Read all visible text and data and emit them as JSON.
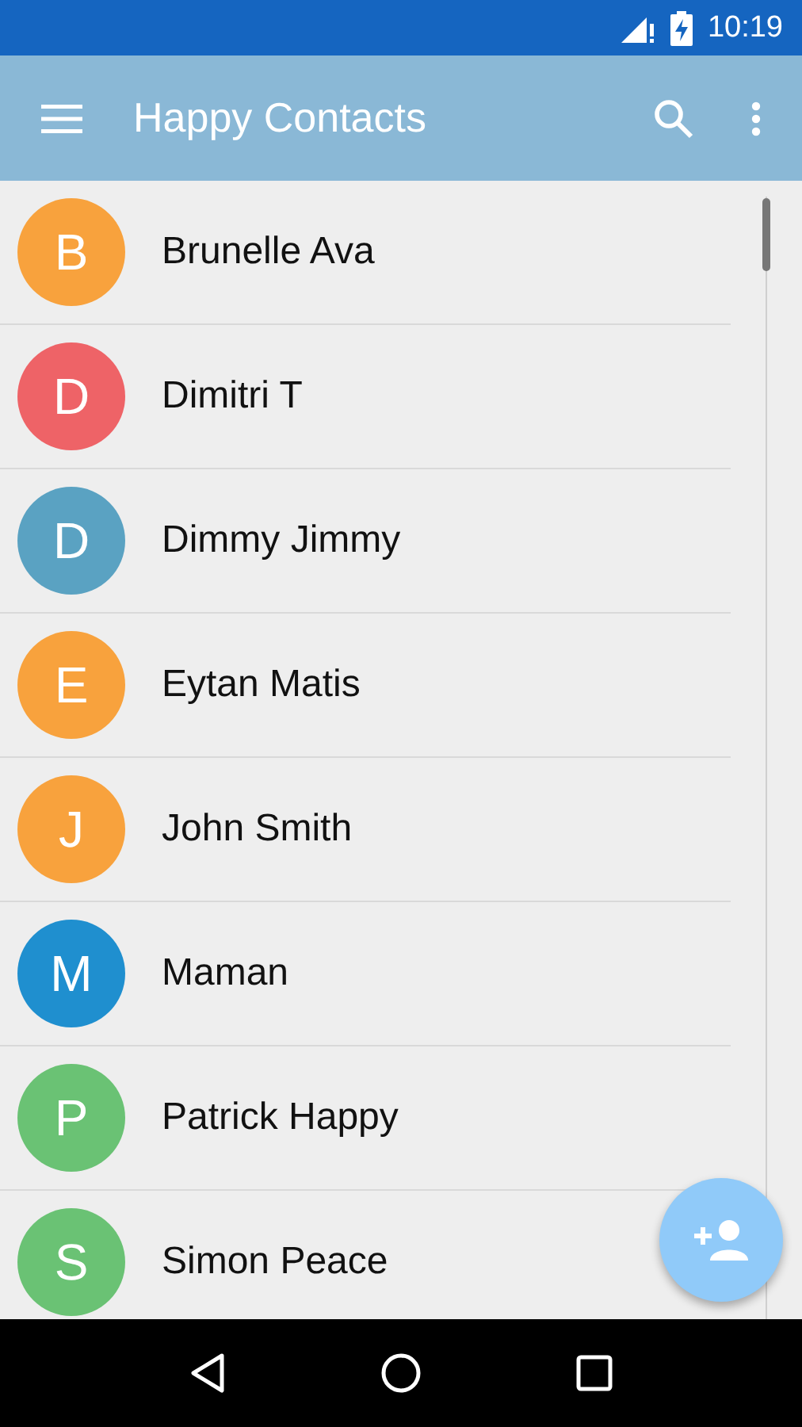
{
  "status_bar": {
    "time": "10:19"
  },
  "app_bar": {
    "title": "Happy Contacts"
  },
  "contacts": [
    {
      "initial": "B",
      "name": "Brunelle Ava",
      "color": "#f8a23d"
    },
    {
      "initial": "D",
      "name": "Dimitri T",
      "color": "#ee6367"
    },
    {
      "initial": "D",
      "name": "Dimmy Jimmy",
      "color": "#5aa2c2"
    },
    {
      "initial": "E",
      "name": "Eytan Matis",
      "color": "#f8a23d"
    },
    {
      "initial": "J",
      "name": "John Smith",
      "color": "#f8a23d"
    },
    {
      "initial": "M",
      "name": "Maman",
      "color": "#1f8fcf"
    },
    {
      "initial": "P",
      "name": "Patrick Happy",
      "color": "#6ac274"
    },
    {
      "initial": "S",
      "name": "Simon Peace",
      "color": "#6ac274"
    }
  ]
}
